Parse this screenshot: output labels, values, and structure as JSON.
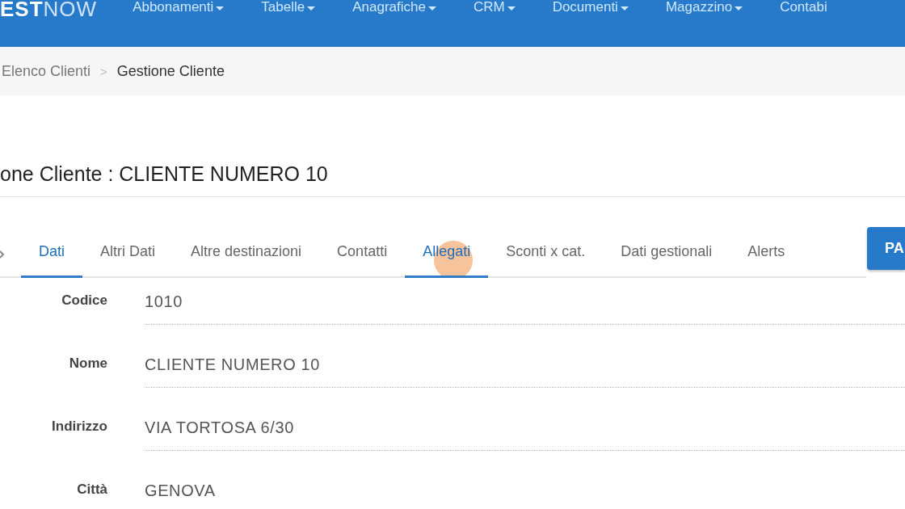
{
  "navbar": {
    "logo": {
      "bold_part": "EST",
      "light_part": "NOW"
    },
    "menu": [
      {
        "label": "Abbonamenti",
        "has_dropdown": true
      },
      {
        "label": "Tabelle",
        "has_dropdown": true
      },
      {
        "label": "Anagrafiche",
        "has_dropdown": true
      },
      {
        "label": "CRM",
        "has_dropdown": true
      },
      {
        "label": "Documenti",
        "has_dropdown": true
      },
      {
        "label": "Magazzino",
        "has_dropdown": true
      },
      {
        "label": "Contabi",
        "has_dropdown": false
      }
    ]
  },
  "breadcrumb_separator": ">",
  "breadcrumb": [
    {
      "label": "Elenco Clienti",
      "current": false
    },
    {
      "label": "Gestione Cliente",
      "current": true
    }
  ],
  "page_title": "one Cliente : CLIENTE NUMERO 10",
  "tabs": [
    {
      "label": "Dati",
      "selected": true
    },
    {
      "label": "Altri Dati",
      "selected": false
    },
    {
      "label": "Altre destinazioni",
      "selected": false
    },
    {
      "label": "Contatti",
      "selected": false
    },
    {
      "label": "Allegati",
      "selected": true
    },
    {
      "label": "Sconti x cat.",
      "selected": false
    },
    {
      "label": "Dati gestionali",
      "selected": false
    },
    {
      "label": "Alerts",
      "selected": false
    }
  ],
  "action_button": "PA",
  "fields": [
    {
      "label": "Codice",
      "value": "1010"
    },
    {
      "label": "Nome",
      "value": "CLIENTE NUMERO 10"
    },
    {
      "label": "Indirizzo",
      "value": "VIA TORTOSA 6/30"
    },
    {
      "label": "Città",
      "value": "GENOVA"
    }
  ]
}
